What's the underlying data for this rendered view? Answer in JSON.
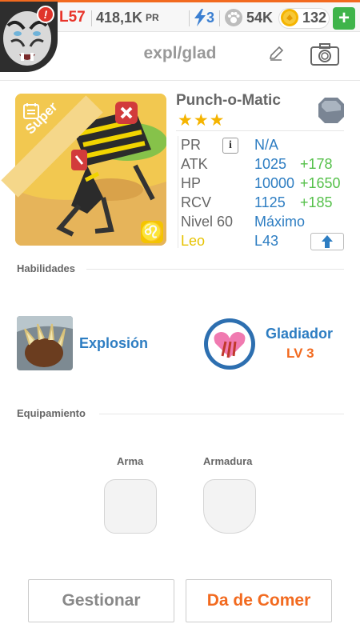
{
  "topbar": {
    "alert_badge": "!",
    "level": "L57",
    "pr_value": "418,1K",
    "pr_unit": "PR",
    "energy": "3",
    "paws": "54K",
    "coins": "132",
    "add_label": "+"
  },
  "header": {
    "title": "expl/glad"
  },
  "monster": {
    "name": "Punch-o-Matic",
    "stars": "★★★",
    "card_label": "Super",
    "zodiac_symbol": "♌",
    "stats": {
      "pr_label": "PR",
      "pr_info": "i",
      "pr_value": "N/A",
      "atk_label": "ATK",
      "atk_value": "1025",
      "atk_bonus": "+178",
      "hp_label": "HP",
      "hp_value": "10000",
      "hp_bonus": "+1650",
      "rcv_label": "RCV",
      "rcv_value": "1125",
      "rcv_bonus": "+185",
      "level_label": "Nivel 60",
      "level_value": "Máximo",
      "sign_label": "Leo",
      "sign_value": "L43"
    }
  },
  "abilities": {
    "section_label": "Habilidades",
    "ability_name": "Explosión",
    "gladiator_name": "Gladiador",
    "gladiator_level": "LV 3"
  },
  "equipment": {
    "section_label": "Equipamiento",
    "weapon_label": "Arma",
    "armor_label": "Armadura"
  },
  "buttons": {
    "manage": "Gestionar",
    "feed": "Da de Comer"
  },
  "colors": {
    "accent_orange": "#f26a1f",
    "value_blue": "#2d7dc2",
    "bonus_green": "#55c04a",
    "level_red": "#e8342a",
    "zodiac_yellow": "#f5c400"
  }
}
